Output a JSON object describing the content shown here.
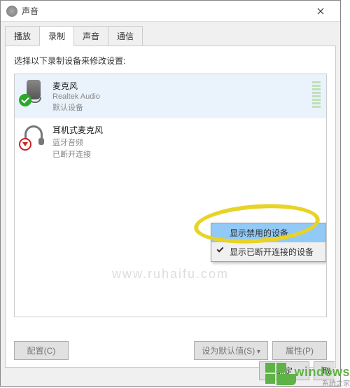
{
  "window": {
    "title": "声音"
  },
  "tabs": {
    "playback": "播放",
    "record": "录制",
    "sound": "声音",
    "comm": "通信"
  },
  "instruction": "选择以下录制设备来修改设置:",
  "devices": [
    {
      "name": "麦克风",
      "sub1": "Realtek Audio",
      "sub2": "默认设备"
    },
    {
      "name": "耳机式麦克风",
      "sub1": "蓝牙音频",
      "sub2": "已断开连接"
    }
  ],
  "context": {
    "show_disabled": "显示禁用的设备",
    "show_disconnected": "显示已断开连接的设备"
  },
  "buttons": {
    "configure": "配置(C)",
    "set_default": "设为默认值(S)",
    "properties": "属性(P)",
    "ok": "确定",
    "cancel": "取"
  },
  "watermark": {
    "main": "windows",
    "sub": "系统之家",
    "faint": "www.ruhaifu.com"
  }
}
